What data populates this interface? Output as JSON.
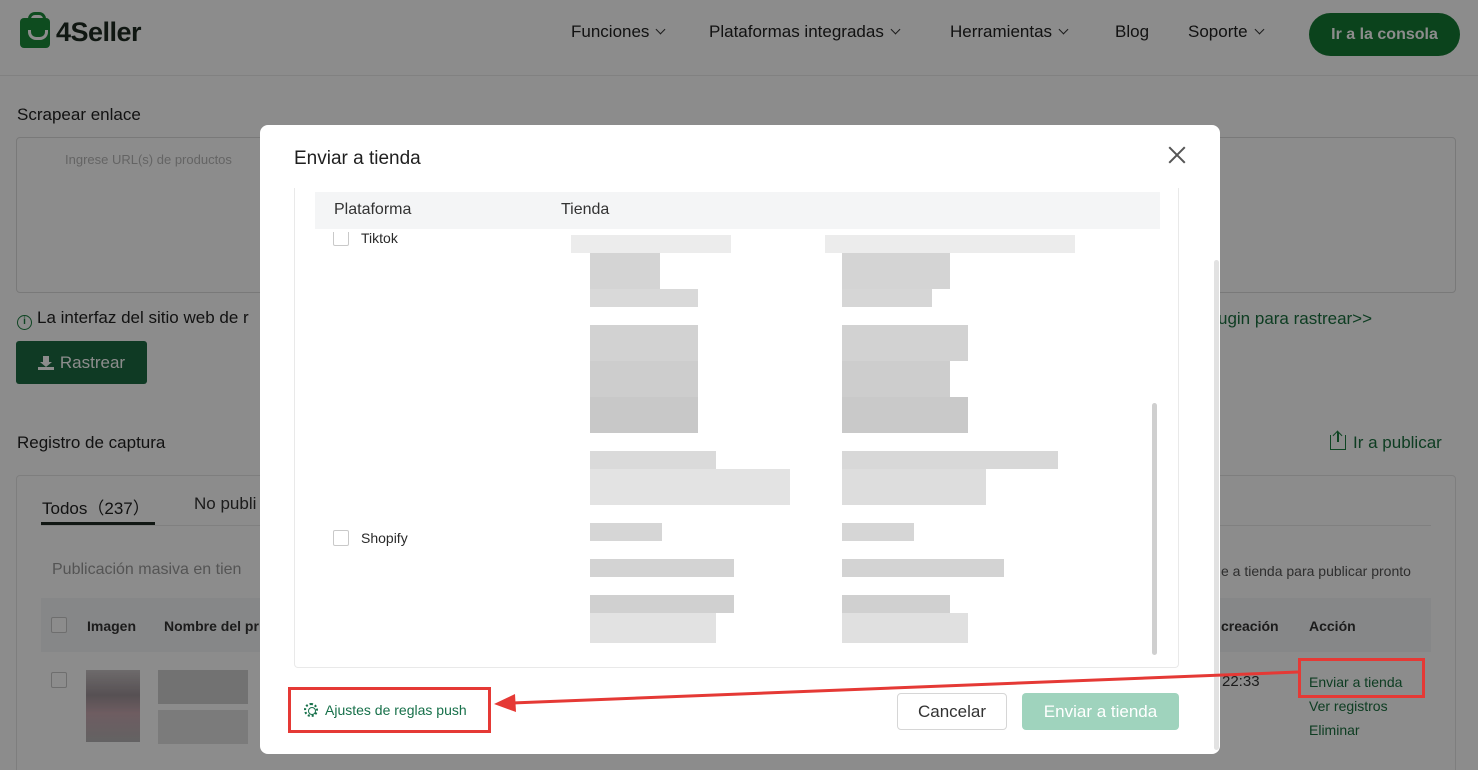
{
  "header": {
    "logo_text": "4Seller",
    "nav": [
      {
        "label": "Funciones",
        "has_dropdown": true
      },
      {
        "label": "Plataformas integradas",
        "has_dropdown": true
      },
      {
        "label": "Herramientas",
        "has_dropdown": true
      },
      {
        "label": "Blog",
        "has_dropdown": false
      },
      {
        "label": "Soporte",
        "has_dropdown": true
      }
    ],
    "console_button": "Ir a la consola"
  },
  "scrape": {
    "title": "Scrapear enlace",
    "url_placeholder": "Ingrese URL(s) de productos",
    "info_text": "La interfaz del sitio web de r",
    "plugin_link": "ugin para rastrear>>",
    "rastrear_button": "Rastrear"
  },
  "records": {
    "title": "Registro de captura",
    "publish_link": "Ir a publicar",
    "tabs": [
      {
        "label": "Todos（237）",
        "active": true
      },
      {
        "label": "No publi",
        "active": false
      }
    ],
    "bulk_text": "Publicación masiva en tien",
    "bulk_hint": "e a tienda para publicar pronto",
    "columns": {
      "image": "Imagen",
      "name": "Nombre del pr",
      "created": "creación",
      "action": "Acción"
    },
    "row": {
      "time": "22:33",
      "actions": [
        "Enviar a tienda",
        "Ver registros",
        "Eliminar"
      ]
    }
  },
  "modal": {
    "title": "Enviar a tienda",
    "columns": {
      "platform": "Plataforma",
      "store": "Tienda"
    },
    "platforms": [
      "Tiktok",
      "Shopify"
    ],
    "push_settings_label": "Ajustes de reglas push",
    "cancel_label": "Cancelar",
    "send_label": "Enviar a tienda"
  },
  "colors": {
    "brand_green": "#157a33",
    "link_green": "#17704a",
    "send_disabled": "#9fd3bd",
    "annotation_red": "#e53935"
  }
}
